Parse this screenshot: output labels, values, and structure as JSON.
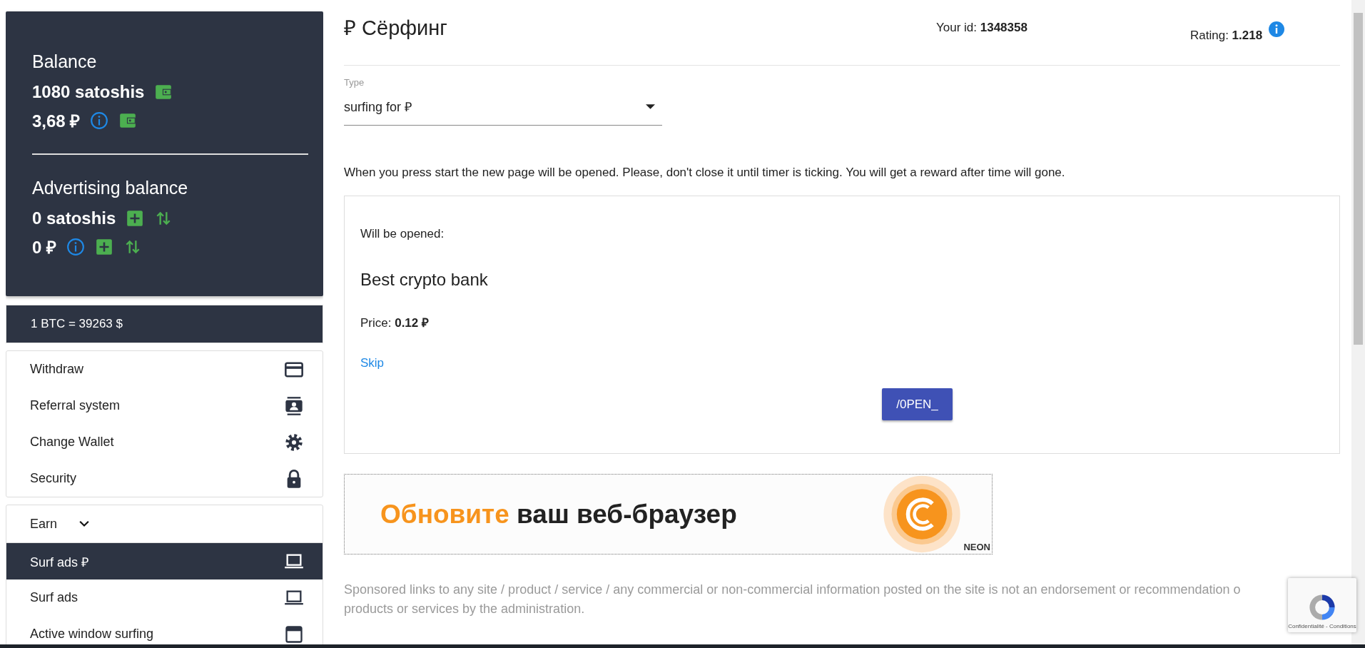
{
  "balance": {
    "title": "Balance",
    "amounts": [
      {
        "value": "1080 satoshis"
      },
      {
        "value": "3,68 ₽"
      }
    ]
  },
  "advertising_balance": {
    "title": "Advertising balance",
    "amounts": [
      {
        "value": "0 satoshis"
      },
      {
        "value": "0 ₽"
      }
    ]
  },
  "rate": "1 BTC = 39263 $",
  "menu": [
    {
      "label": "Withdraw"
    },
    {
      "label": "Referral system"
    },
    {
      "label": "Change Wallet"
    },
    {
      "label": "Security"
    }
  ],
  "earn": {
    "label": "Earn",
    "expanded": true,
    "items": [
      {
        "label": "Surf ads ₽",
        "selected": true
      },
      {
        "label": "Surf ads",
        "selected": false
      },
      {
        "label": "Active window surfing",
        "selected": false
      }
    ]
  },
  "header": {
    "title": "₽ Сёрфинг",
    "id_label": "Your id:",
    "id_value": "1348358",
    "rating_label": "Rating:",
    "rating_value": "1.218"
  },
  "type_select": {
    "label": "Type",
    "value": "surfing for ₽"
  },
  "instructions": "When you press start the new page will be opened. Please, don't close it until timer is ticking. You will get a reward after time will gone.",
  "task": {
    "caption": "Will be opened:",
    "name": "Best crypto bank",
    "price_label": "Price:",
    "price_value": "0.12 ₽",
    "skip": "Skip",
    "button": "/0PEN_"
  },
  "banner": {
    "highlight": "Обновите",
    "text": "ваш веб-браузер",
    "brand": "NEON"
  },
  "disclaimer": [
    "Sponsored links to any site / product / service / any commercial or non-commercial information posted on the site is not an endorsement or recommendation o",
    "products or services by the administration."
  ],
  "recaptcha": {
    "links": "Confidentialité - Conditions"
  }
}
